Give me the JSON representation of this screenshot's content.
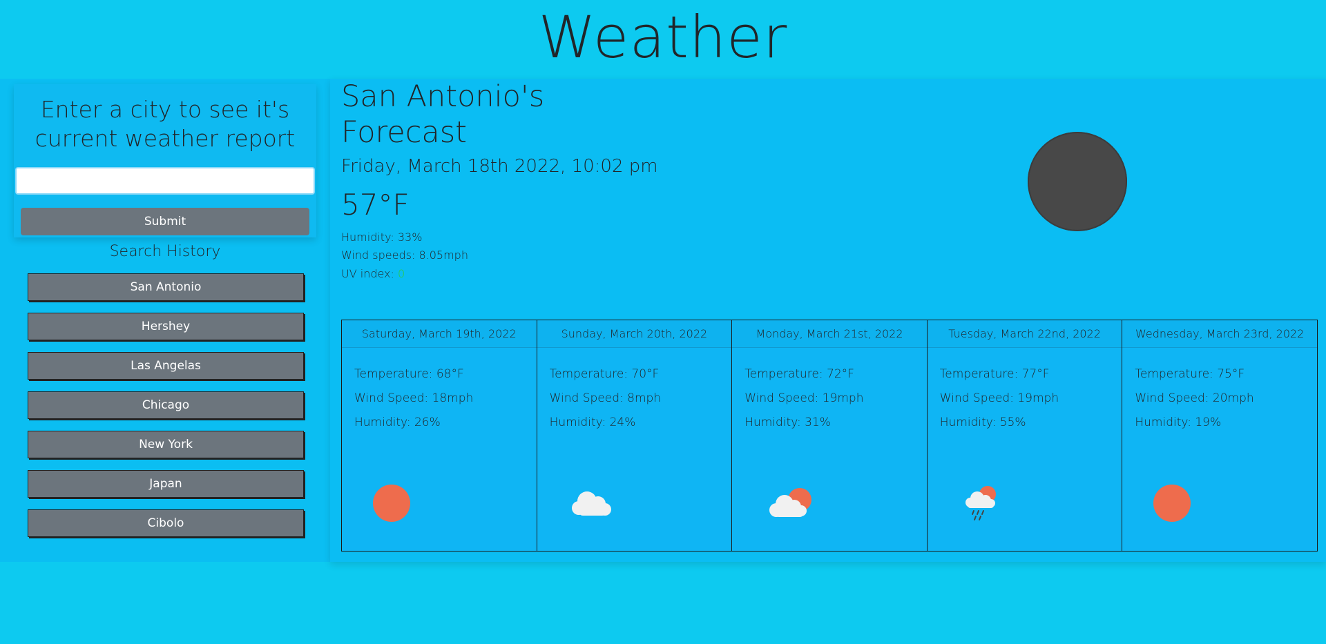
{
  "header": {
    "title": "Weather"
  },
  "search": {
    "prompt": "Enter a city to see it's current weather report",
    "input_value": "",
    "submit_label": "Submit"
  },
  "history": {
    "title": "Search History",
    "items": [
      "San Antonio",
      "Hershey",
      "Las Angelas",
      "Chicago",
      "New York",
      "Japan",
      "Cibolo"
    ]
  },
  "current": {
    "heading": "San Antonio's Forecast",
    "date": "Friday, March 18th 2022, 10:02 pm",
    "temperature": "57°F",
    "humidity": "Humidity: 33%",
    "wind": "Wind speeds: 8.05mph",
    "uv_label": "UV index: ",
    "uv_value": "0",
    "uv_color": "#2ecc40",
    "icon": "moon-icon"
  },
  "forecast": [
    {
      "date": "Saturday, March 19th, 2022",
      "temperature": "Temperature: 68°F",
      "wind": "Wind Speed: 18mph",
      "humidity": "Humidity: 26%",
      "icon": "sun-icon"
    },
    {
      "date": "Sunday, March 20th, 2022",
      "temperature": "Temperature: 70°F",
      "wind": "Wind Speed: 8mph",
      "humidity": "Humidity: 24%",
      "icon": "cloud-icon"
    },
    {
      "date": "Monday, March 21st, 2022",
      "temperature": "Temperature: 72°F",
      "wind": "Wind Speed: 19mph",
      "humidity": "Humidity: 31%",
      "icon": "partly-cloudy-icon"
    },
    {
      "date": "Tuesday, March 22nd, 2022",
      "temperature": "Temperature: 77°F",
      "wind": "Wind Speed: 19mph",
      "humidity": "Humidity: 55%",
      "icon": "rain-icon"
    },
    {
      "date": "Wednesday, March 23rd, 2022",
      "temperature": "Temperature: 75°F",
      "wind": "Wind Speed: 20mph",
      "humidity": "Humidity: 19%",
      "icon": "sun-icon"
    }
  ]
}
